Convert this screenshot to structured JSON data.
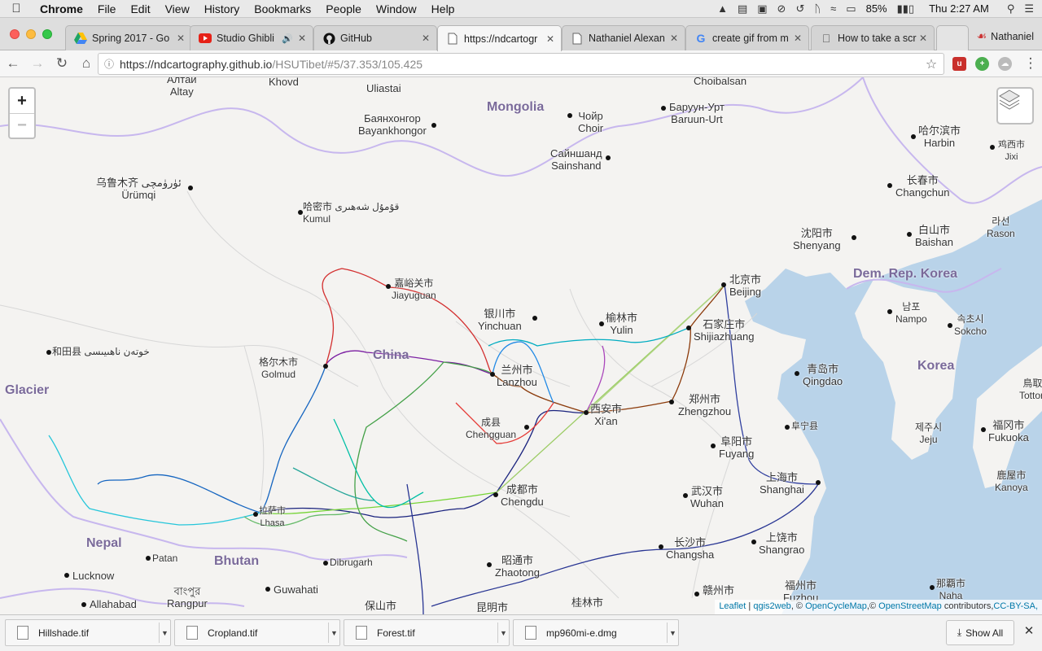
{
  "menubar": {
    "app": "Chrome",
    "items": [
      "File",
      "Edit",
      "View",
      "History",
      "Bookmarks",
      "People",
      "Window",
      "Help"
    ],
    "battery": "85%",
    "clock": "Thu 2:27 AM"
  },
  "tabs": [
    {
      "label": "Spring 2017 - Go",
      "icon": "google-drive-icon",
      "active": false
    },
    {
      "label": "Studio Ghibli",
      "icon": "youtube-icon",
      "active": false
    },
    {
      "label": "GitHub",
      "icon": "github-icon",
      "active": false
    },
    {
      "label": "https://ndcartogr",
      "icon": "page-icon",
      "active": true
    },
    {
      "label": "Nathaniel Alexan",
      "icon": "page-icon",
      "active": false
    },
    {
      "label": "create gif from m",
      "icon": "google-icon",
      "active": false
    },
    {
      "label": "How to take a scr",
      "icon": "apple-icon",
      "active": false
    }
  ],
  "profile": "Nathaniel",
  "omnibox": {
    "host": "https://ndcartography.github.io",
    "path": "/HSUTibet/#5/37.353/105.425"
  },
  "map": {
    "countries": [
      "Mongolia",
      "China",
      "Dem. Rep. Korea",
      "Korea",
      "Nepal",
      "Bhutan",
      "Glacier"
    ],
    "cities": [
      {
        "native": "Алтай",
        "latin": "Altay"
      },
      {
        "native": "",
        "latin": "Khovd"
      },
      {
        "native": "",
        "latin": "Uliastai"
      },
      {
        "native": "",
        "latin": "Choibalsan"
      },
      {
        "native": "Баянхонгор",
        "latin": "Bayankhongor"
      },
      {
        "native": "Чойр",
        "latin": "Choir"
      },
      {
        "native": "Баруун-Урт",
        "latin": "Baruun-Urt"
      },
      {
        "native": "Сайншанд",
        "latin": "Sainshand"
      },
      {
        "native": "哈尔滨市",
        "latin": "Harbin"
      },
      {
        "native": "鸡西市",
        "latin": "Jixi"
      },
      {
        "native": "乌鲁木齐 ئۈرۈمچى",
        "latin": "Ürümqi"
      },
      {
        "native": "哈密市 قۇمۇل شەھىرى",
        "latin": "Kumul"
      },
      {
        "native": "长春市",
        "latin": "Changchun"
      },
      {
        "native": "沈阳市",
        "latin": "Shenyang"
      },
      {
        "native": "白山市",
        "latin": "Baishan"
      },
      {
        "native": "라선",
        "latin": "Rason"
      },
      {
        "native": "嘉峪关市",
        "latin": "Jiayuguan"
      },
      {
        "native": "北京市",
        "latin": "Beijing"
      },
      {
        "native": "银川市",
        "latin": "Yinchuan"
      },
      {
        "native": "榆林市",
        "latin": "Yulin"
      },
      {
        "native": "石家庄市",
        "latin": "Shijiazhuang"
      },
      {
        "native": "남포",
        "latin": "Nampo"
      },
      {
        "native": "속초시",
        "latin": "Sokcho"
      },
      {
        "native": "和田县 خوتەن ناھىيىسى",
        "latin": ""
      },
      {
        "native": "格尔木市",
        "latin": "Golmud"
      },
      {
        "native": "兰州市",
        "latin": "Lanzhou"
      },
      {
        "native": "青岛市",
        "latin": "Qingdao"
      },
      {
        "native": "郑州市",
        "latin": "Zhengzhou"
      },
      {
        "native": "西安市",
        "latin": "Xi'an"
      },
      {
        "native": "成县",
        "latin": "Chengguan"
      },
      {
        "native": "阜宁县",
        "latin": ""
      },
      {
        "native": "제주시",
        "latin": "Jeju"
      },
      {
        "native": "福冈市",
        "latin": "Fukuoka"
      },
      {
        "native": "阜阳市",
        "latin": "Fuyang"
      },
      {
        "native": "成都市",
        "latin": "Chengdu"
      },
      {
        "native": "上海市",
        "latin": "Shanghai"
      },
      {
        "native": "鹿屋市",
        "latin": "Kanoya"
      },
      {
        "native": "武汉市",
        "latin": "Wuhan"
      },
      {
        "native": "拉萨市",
        "latin": "Lhasa"
      },
      {
        "native": "长沙市",
        "latin": "Changsha"
      },
      {
        "native": "上饶市",
        "latin": "Shangrao"
      },
      {
        "native": "",
        "latin": "Patan"
      },
      {
        "native": "",
        "latin": "Dibrugarh"
      },
      {
        "native": "昭通市",
        "latin": "Zhaotong"
      },
      {
        "native": "",
        "latin": "Lucknow"
      },
      {
        "native": "",
        "latin": "Guwahati"
      },
      {
        "native": "বাংপুর",
        "latin": "Rangpur"
      },
      {
        "native": "",
        "latin": "Allahabad"
      },
      {
        "native": "保山市",
        "latin": ""
      },
      {
        "native": "昆明市",
        "latin": ""
      },
      {
        "native": "桂林市",
        "latin": ""
      },
      {
        "native": "赣州市",
        "latin": ""
      },
      {
        "native": "福州市",
        "latin": "Fuzhou"
      },
      {
        "native": "那覇市",
        "latin": "Naha"
      },
      {
        "native": "鳥取",
        "latin": "Tottori"
      }
    ],
    "zoom_in": "+",
    "zoom_out": "−",
    "attribution": {
      "leaflet": "Leaflet",
      "qgis": "qgis2web",
      "ocm": "OpenCycleMap",
      "osm": "OpenStreetMap",
      "rest": "contributors,",
      "license": "CC-BY-SA,"
    }
  },
  "downloads": {
    "files": [
      "Hillshade.tif",
      "Cropland.tif",
      "Forest.tif",
      "mp960mi-e.dmg"
    ],
    "show_all": "Show All"
  }
}
